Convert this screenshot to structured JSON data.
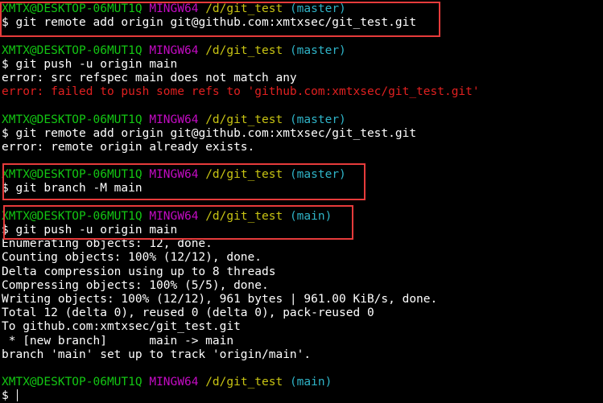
{
  "prompt": {
    "user": "XMTX@DESKTOP-06MUT1Q",
    "system": "MINGW64",
    "path": "/d/git_test",
    "symbol": "$"
  },
  "blocks": [
    {
      "branch": "(master)",
      "command": "git remote add origin git@github.com:xmtxsec/git_test.git",
      "output": []
    },
    {
      "branch": "(master)",
      "command": "git push -u origin main",
      "output": [
        {
          "text": "error: src refspec main does not match any",
          "style": "normal"
        },
        {
          "text": "error: failed to push some refs to 'github.com:xmtxsec/git_test.git'",
          "style": "error"
        }
      ]
    },
    {
      "branch": "(master)",
      "command": "git remote add origin git@github.com:xmtxsec/git_test.git",
      "output": [
        {
          "text": "error: remote origin already exists.",
          "style": "normal"
        }
      ]
    },
    {
      "branch": "(master)",
      "command": "git branch -M main",
      "output": []
    },
    {
      "branch": "(main)",
      "command": "git push -u origin main",
      "output": [
        {
          "text": "Enumerating objects: 12, done.",
          "style": "normal"
        },
        {
          "text": "Counting objects: 100% (12/12), done.",
          "style": "normal"
        },
        {
          "text": "Delta compression using up to 8 threads",
          "style": "normal"
        },
        {
          "text": "Compressing objects: 100% (5/5), done.",
          "style": "normal"
        },
        {
          "text": "Writing objects: 100% (12/12), 961 bytes | 961.00 KiB/s, done.",
          "style": "normal"
        },
        {
          "text": "Total 12 (delta 0), reused 0 (delta 0), pack-reused 0",
          "style": "normal"
        },
        {
          "text": "To github.com:xmtxsec/git_test.git",
          "style": "normal"
        },
        {
          "text": " * [new branch]      main -> main",
          "style": "normal"
        },
        {
          "text": "branch 'main' set up to track 'origin/main'.",
          "style": "normal"
        }
      ]
    },
    {
      "branch": "(main)",
      "command": "",
      "output": []
    }
  ],
  "colors": {
    "background": "#000000",
    "user": "#13c613",
    "system": "#c40bc4",
    "path": "#c8c413",
    "branch": "#2fb4c8",
    "error": "#e02020",
    "highlight": "#e63b3b"
  }
}
